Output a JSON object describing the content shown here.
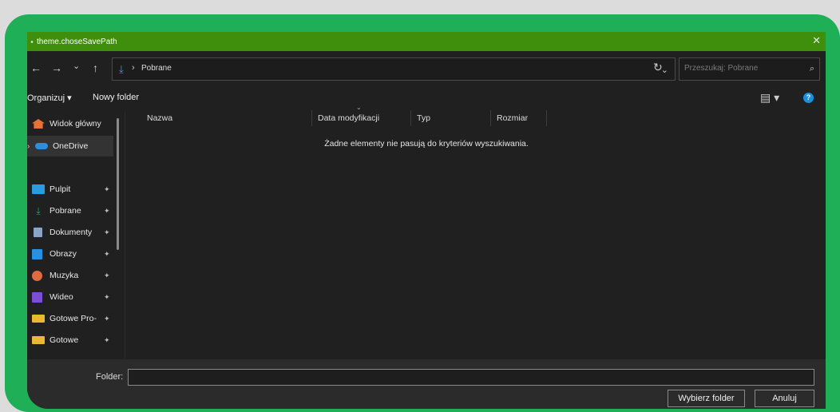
{
  "window": {
    "title": "theme.choseSavePath",
    "title_icon": "app-icon",
    "close_glyph": "✕"
  },
  "nav": {
    "back_glyph": "←",
    "forward_glyph": "→",
    "recent_glyph": "⌄",
    "up_glyph": "↑",
    "breadcrumb_sep": "›",
    "path": "Pobrane",
    "address_dropdown_glyph": "⌄",
    "refresh_glyph": "↻",
    "search_placeholder": "Przeszukaj: Pobrane",
    "search_glyph": "⌕"
  },
  "toolbar": {
    "organize": "Organizuj ▾",
    "new_folder": "Nowy folder",
    "view_glyph": "▤ ▾",
    "help_glyph": "?"
  },
  "sidebar": {
    "items": [
      {
        "label": "Widok główny",
        "icon": "home-icon",
        "color": "#e8713a"
      },
      {
        "label": "OneDrive",
        "icon": "cloud-icon",
        "color": "#2b8fe0",
        "selected": true,
        "expandable": true
      },
      {
        "label": "Pulpit",
        "icon": "desktop-icon",
        "color": "#2b9be0",
        "pinned": true
      },
      {
        "label": "Pobrane",
        "icon": "download-icon",
        "color": "#22a86a",
        "pinned": true
      },
      {
        "label": "Dokumenty",
        "icon": "document-icon",
        "color": "#8aa4c8",
        "pinned": true
      },
      {
        "label": "Obrazy",
        "icon": "pictures-icon",
        "color": "#2b8fe0",
        "pinned": true
      },
      {
        "label": "Muzyka",
        "icon": "music-icon",
        "color": "#e06a40",
        "pinned": true
      },
      {
        "label": "Wideo",
        "icon": "video-icon",
        "color": "#7a4fd6",
        "pinned": true
      },
      {
        "label": "Gotowe Pro-",
        "icon": "folder-icon",
        "color": "#e8b930",
        "pinned": true
      },
      {
        "label": "Gotowe",
        "icon": "folder-icon",
        "color": "#e8b930",
        "pinned": true
      }
    ],
    "pin_glyph": "✦",
    "expand_glyph": "›"
  },
  "columns": [
    "Nazwa",
    "Data modyfikacji",
    "Typ",
    "Rozmiar"
  ],
  "sort_glyph": "⌄",
  "empty_message": "Żadne elementy nie pasują do kryteriów wyszukiwania.",
  "footer": {
    "folder_label": "Folder:",
    "folder_value": "",
    "select_button": "Wybierz folder",
    "cancel_button": "Anuluj"
  },
  "colors": {
    "frame": "#1fb057",
    "titlebar": "#3f8e0c",
    "window_bg": "#202020",
    "accent": "#1a90e0"
  }
}
